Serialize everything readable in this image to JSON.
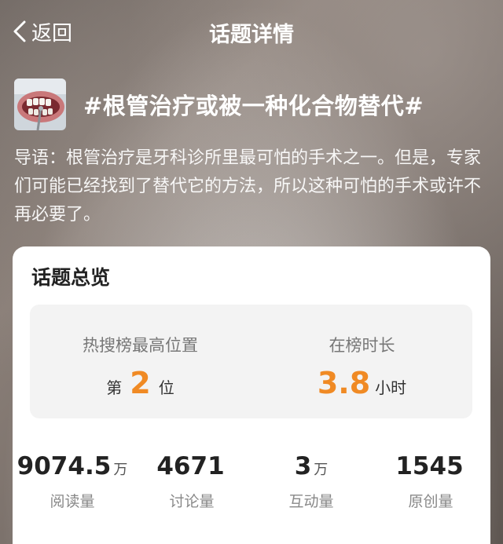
{
  "nav": {
    "back_label": "返回",
    "title": "话题详情"
  },
  "topic": {
    "thumbnail_icon": "teeth-photo",
    "title": "#根管治疗或被一种化合物替代#",
    "intro": "导语：根管治疗是牙科诊所里最可怕的手术之一。但是，专家们可能已经找到了替代它的方法，所以这种可怕的手术或许不再必要了。"
  },
  "overview": {
    "title": "话题总览",
    "rank": {
      "label": "热搜榜最高位置",
      "prefix": "第",
      "value": "2",
      "suffix": "位"
    },
    "duration": {
      "label": "在榜时长",
      "value": "3.8",
      "unit": "小时"
    },
    "metrics": [
      {
        "value": "9074.5",
        "unit": "万",
        "label": "阅读量"
      },
      {
        "value": "4671",
        "unit": "",
        "label": "讨论量"
      },
      {
        "value": "3",
        "unit": "万",
        "label": "互动量"
      },
      {
        "value": "1545",
        "unit": "",
        "label": "原创量"
      }
    ]
  },
  "colors": {
    "accent": "#f08a24",
    "card_bg": "#ffffff",
    "stat_box_bg": "#f3f3f3"
  }
}
